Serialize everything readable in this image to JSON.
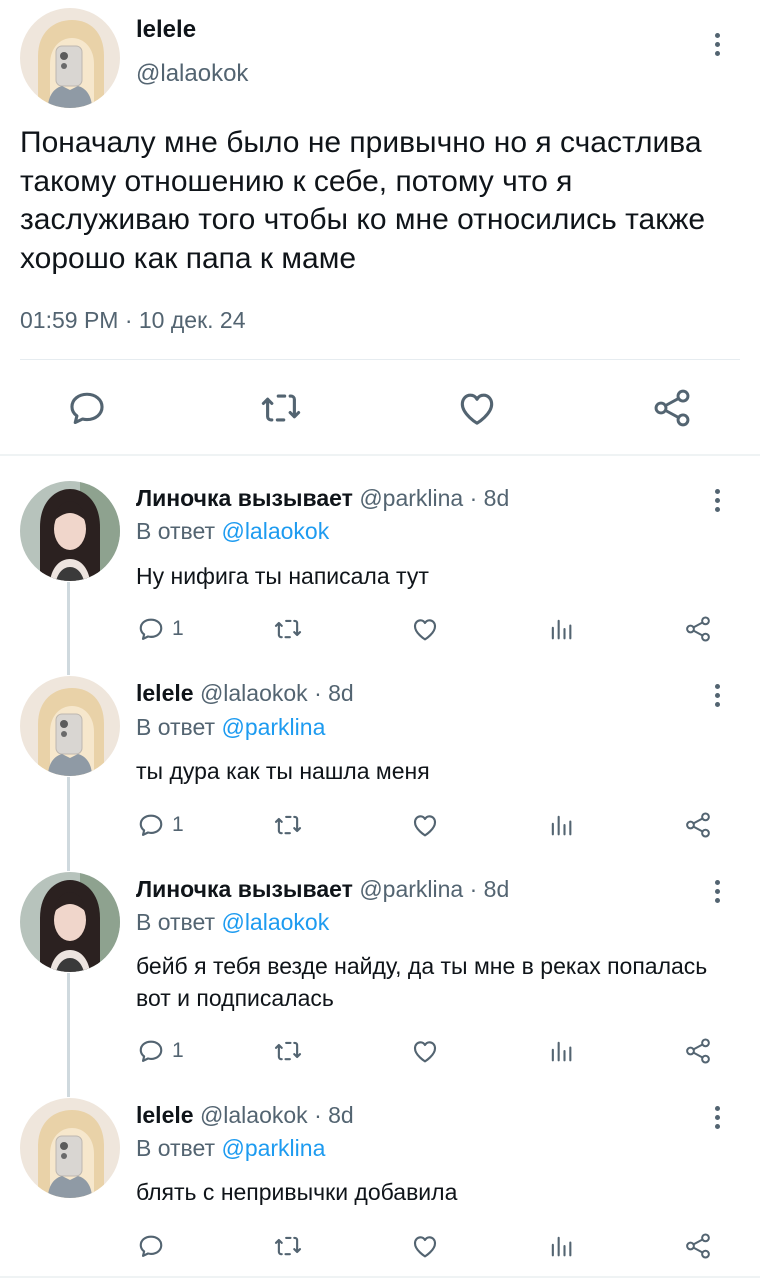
{
  "colors": {
    "text": "#0f1419",
    "secondary": "#536471",
    "link": "#1d9bf0",
    "divider": "#e6ecf0"
  },
  "main_tweet": {
    "author_name": "lelele",
    "author_handle": "@lalaokok",
    "text": "Поначалу мне было не привычно но я счастлива такому отношению к себе, потому что я заслуживаю того чтобы ко мне относились также хорошо как папа к маме",
    "timestamp": "01:59 PM · 10 дек. 24",
    "actions": [
      "reply-icon",
      "retweet-icon",
      "like-icon",
      "share-icon"
    ]
  },
  "replies": [
    {
      "name": "Линочка вызывает",
      "handle": "@parklina",
      "time": "· 8d",
      "reply_prefix": "В ответ",
      "reply_to": "@lalaokok",
      "text": "Ну нифига ты написала тут",
      "reply_count": "1"
    },
    {
      "name": "lelele",
      "handle": "@lalaokok",
      "time": "· 8d",
      "reply_prefix": "В ответ",
      "reply_to": "@parklina",
      "text": "ты дура как ты нашла меня",
      "reply_count": "1"
    },
    {
      "name": "Линочка вызывает",
      "handle": "@parklina",
      "time": "· 8d",
      "reply_prefix": "В ответ",
      "reply_to": "@lalaokok",
      "text": "бейб я тебя везде найду, да ты мне в реках попалась вот и подписалась",
      "reply_count": "1"
    },
    {
      "name": "lelele",
      "handle": "@lalaokok",
      "time": "· 8d",
      "reply_prefix": "В ответ",
      "reply_to": "@parklina",
      "text": "блять с непривычки добавила",
      "reply_count": ""
    }
  ]
}
